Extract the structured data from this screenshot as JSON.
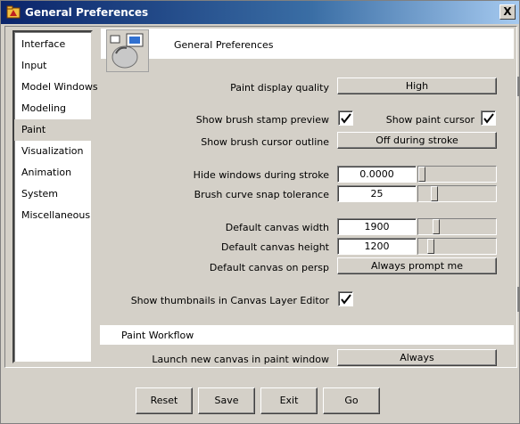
{
  "window": {
    "title": "General Preferences",
    "close_label": "X"
  },
  "sidebar": {
    "items": [
      {
        "label": "Interface"
      },
      {
        "label": "Input"
      },
      {
        "label": "Model Windows"
      },
      {
        "label": "Modeling"
      },
      {
        "label": "Paint",
        "selected": true
      },
      {
        "label": "Visualization"
      },
      {
        "label": "Animation"
      },
      {
        "label": "System"
      },
      {
        "label": "Miscellaneous"
      }
    ]
  },
  "header": {
    "title": "General Preferences",
    "icon": "general-preferences-icon"
  },
  "paint": {
    "display_quality_label": "Paint display quality",
    "display_quality_value": "High",
    "brush_stamp_label": "Show brush stamp preview",
    "brush_stamp_checked": true,
    "paint_cursor_label": "Show paint cursor",
    "paint_cursor_checked": true,
    "cursor_outline_label": "Show brush cursor outline",
    "cursor_outline_value": "Off during stroke",
    "hide_windows_label": "Hide windows during stroke",
    "hide_windows_value": "0.0000",
    "snap_tolerance_label": "Brush curve snap tolerance",
    "snap_tolerance_value": "25",
    "canvas_width_label": "Default canvas width",
    "canvas_width_value": "1900",
    "canvas_height_label": "Default canvas height",
    "canvas_height_value": "1200",
    "canvas_persp_label": "Default canvas on persp",
    "canvas_persp_value": "Always prompt me",
    "thumbnails_label": "Show thumbnails in Canvas Layer Editor",
    "thumbnails_checked": true
  },
  "workflow": {
    "section_title": "Paint Workflow",
    "launch_label": "Launch new canvas in paint window",
    "launch_value": "Always"
  },
  "footer": {
    "reset_label": "Reset",
    "save_label": "Save",
    "exit_label": "Exit",
    "go_label": "Go"
  }
}
